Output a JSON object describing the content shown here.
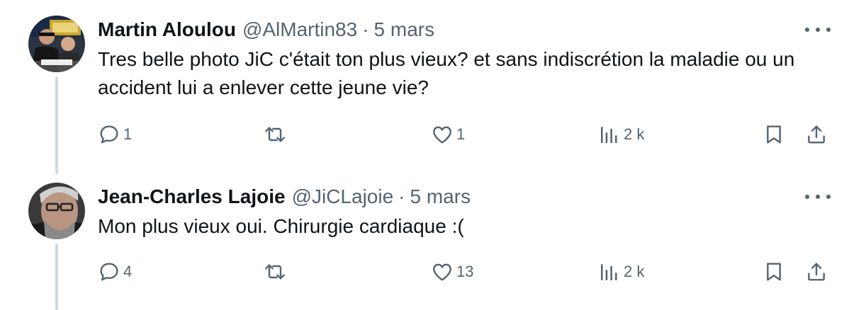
{
  "replies": [
    {
      "name": "Martin Aloulou",
      "handle": "@AlMartin83",
      "separator": "·",
      "time": "5 mars",
      "text": "Tres belle photo JiC c'était ton plus vieux? et sans indiscrétion la maladie ou un accident lui a enlever cette jeune vie?",
      "avatar_lettering": "WRESTLEMANIA",
      "reply_count": "1",
      "retweet_count": "",
      "like_count": "1",
      "views_count": "2 k"
    },
    {
      "name": "Jean-Charles Lajoie",
      "handle": "@JiCLajoie",
      "separator": "·",
      "time": "5 mars",
      "text": "Mon plus vieux oui. Chirurgie cardiaque :(",
      "reply_count": "4",
      "retweet_count": "",
      "like_count": "13",
      "views_count": "2 k"
    }
  ],
  "icons": {
    "reply": "reply-icon",
    "retweet": "retweet-icon",
    "like": "heart-icon",
    "views": "views-icon",
    "bookmark": "bookmark-icon",
    "share": "share-icon",
    "more": "more-icon"
  },
  "colors": {
    "text": "#0f1419",
    "secondary": "#536471",
    "thread_line": "#cfd9de"
  }
}
